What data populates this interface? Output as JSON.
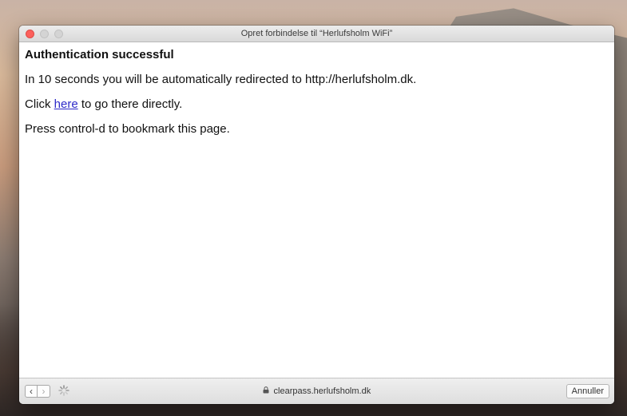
{
  "window": {
    "title": "Opret forbindelse til “Herlufsholm WiFi”"
  },
  "page": {
    "heading": "Authentication successful",
    "redirect_text": "In 10 seconds you will be automatically redirected to http://herlufsholm.dk.",
    "click_prefix": "Click ",
    "link_text": "here",
    "click_suffix": " to go there directly.",
    "bookmark_text": "Press control-d to bookmark this page."
  },
  "bottombar": {
    "back_label": "‹",
    "forward_label": "›",
    "url": "clearpass.herlufsholm.dk",
    "cancel_label": "Annuller"
  },
  "icons": {
    "back": "chevron-left-icon",
    "forward": "chevron-right-icon",
    "loading": "spinner-icon",
    "secure": "lock-icon"
  },
  "colors": {
    "close_light": "#fc605c",
    "link": "#2d2ac8"
  }
}
